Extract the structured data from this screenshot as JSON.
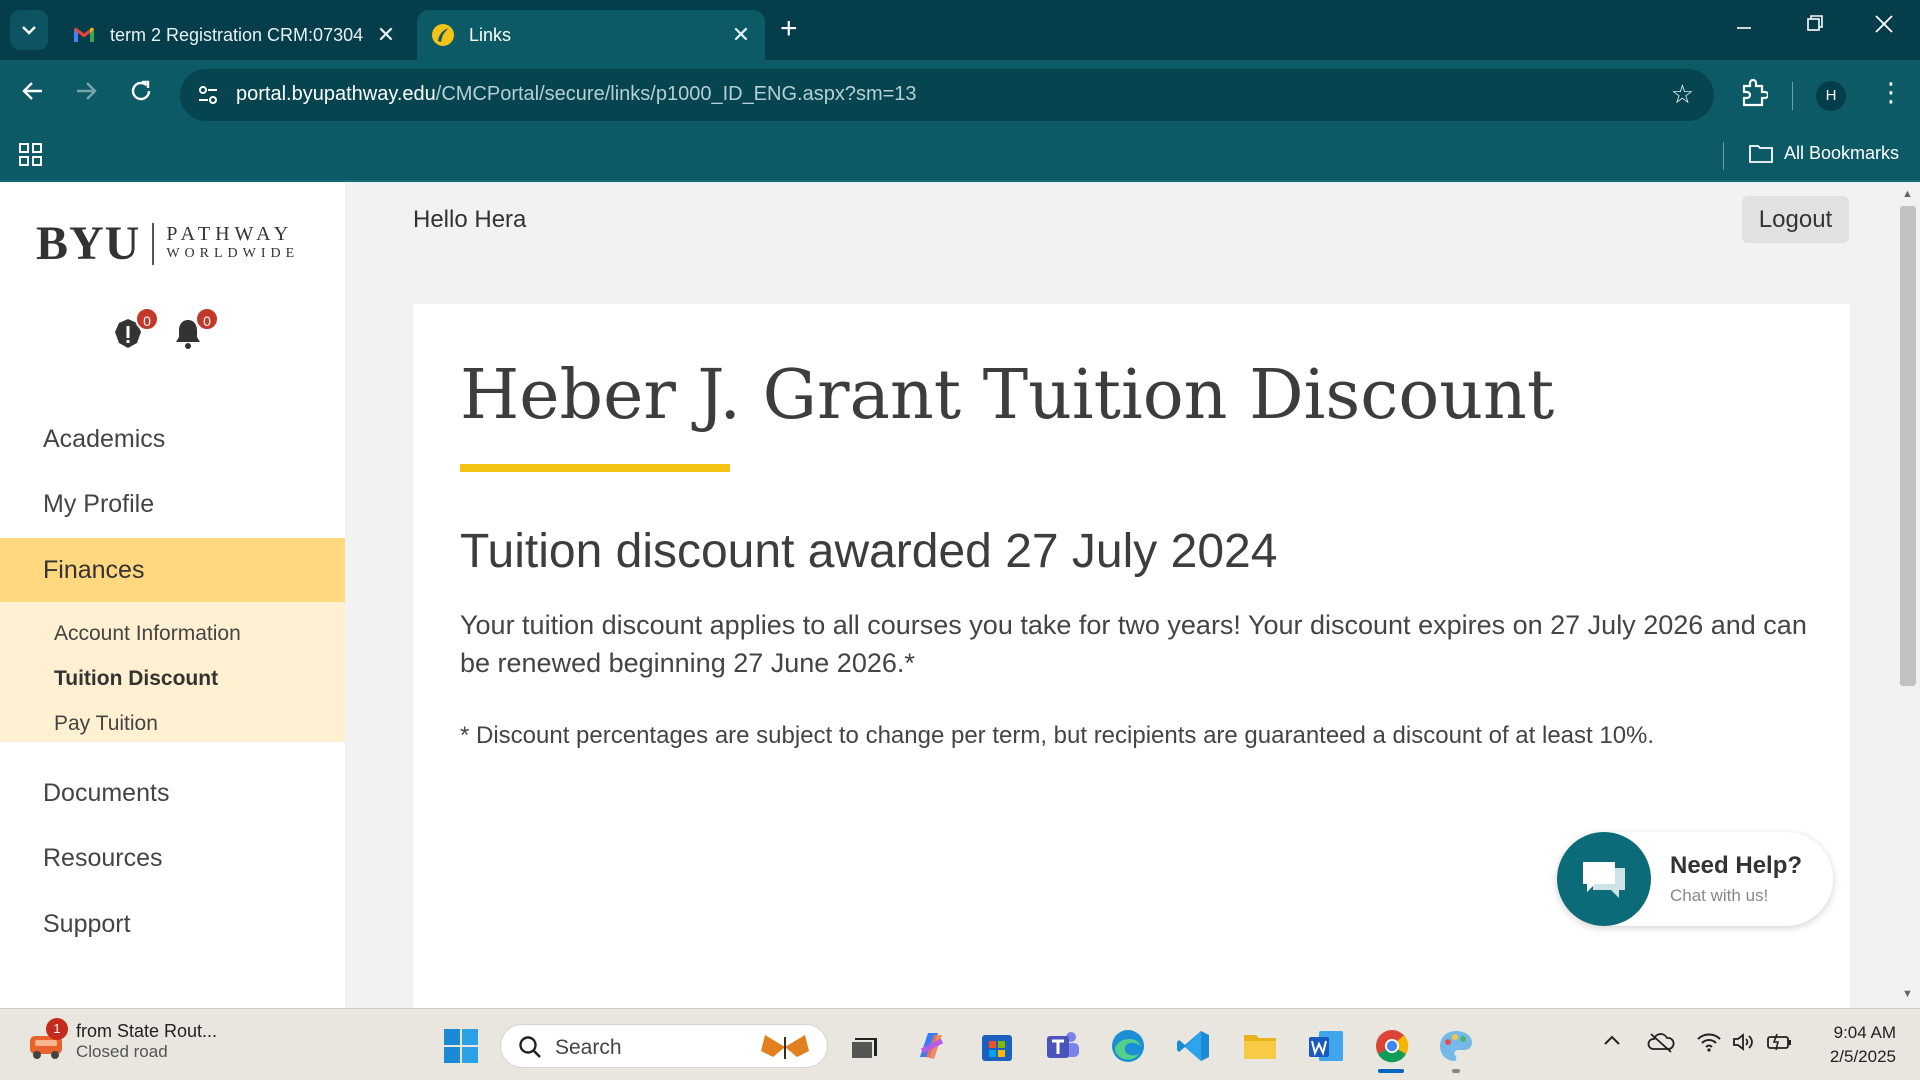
{
  "browser": {
    "tabs": [
      {
        "title": "term 2 Registration CRM:07304",
        "active": false
      },
      {
        "title": "Links",
        "active": true
      }
    ],
    "url_host": "portal.byupathway.edu",
    "url_path": "/CMCPortal/secure/links/p1000_ID_ENG.aspx?sm=13",
    "profile_initial": "H",
    "bookmarks_label": "All Bookmarks"
  },
  "sidebar": {
    "logo": {
      "byu": "BYU",
      "line1": "PATHWAY",
      "line2": "WORLDWIDE"
    },
    "alerts_count": "0",
    "notifications_count": "0",
    "nav": [
      {
        "label": "Academics"
      },
      {
        "label": "My Profile"
      },
      {
        "label": "Finances",
        "active": true
      },
      {
        "label": "Documents"
      },
      {
        "label": "Resources"
      },
      {
        "label": "Support"
      }
    ],
    "finances_sub": [
      {
        "label": "Account Information"
      },
      {
        "label": "Tuition Discount",
        "selected": true
      },
      {
        "label": "Pay Tuition"
      }
    ]
  },
  "header": {
    "greeting": "Hello Hera",
    "logout_label": "Logout"
  },
  "content": {
    "title": "Heber J. Grant Tuition Discount",
    "subtitle": "Tuition discount awarded 27 July 2024",
    "paragraph": "Your tuition discount applies to all courses you take for two years! Your discount expires on 27 July 2026 and can be renewed beginning 27 June 2026.*",
    "footnote": "* Discount percentages are subject to change per term, but recipients are guaranteed a discount of at least 10%."
  },
  "help_widget": {
    "title": "Need Help?",
    "subtitle": "Chat with us!"
  },
  "taskbar": {
    "weather_badge": "1",
    "weather_line1": "from State Rout...",
    "weather_line2": "Closed road",
    "search_label": "Search",
    "time": "9:04 AM",
    "date": "2/5/2025"
  },
  "colors": {
    "chrome_dark": "#053d4a",
    "chrome": "#0b5a66",
    "nav_active": "#ffd87f",
    "subnav_bg": "#fff0d2",
    "accent_gold": "#f4c316",
    "help_teal": "#0b6b78"
  }
}
